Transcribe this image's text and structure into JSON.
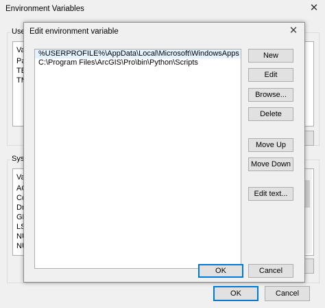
{
  "background_window": {
    "title": "Environment Variables",
    "close_glyph": "✕",
    "user_group_label": "User",
    "user_rows": [
      "Va",
      "Pa",
      "TE",
      "TM"
    ],
    "system_group_label": "Syste",
    "system_rows": [
      "Va",
      "AC",
      "Co",
      "Dr",
      "GD",
      "LS",
      "NU",
      "NU"
    ],
    "ok_label": "OK",
    "cancel_label": "Cancel"
  },
  "dialog": {
    "title": "Edit environment variable",
    "close_glyph": "✕",
    "paths": [
      "%USERPROFILE%\\AppData\\Local\\Microsoft\\WindowsApps",
      "C:\\Program Files\\ArcGIS\\Pro\\bin\\Python\\Scripts"
    ],
    "selected_index": 0,
    "buttons": {
      "new": "New",
      "edit": "Edit",
      "browse": "Browse...",
      "delete": "Delete",
      "move_up": "Move Up",
      "move_down": "Move Down",
      "edit_text": "Edit text...",
      "ok": "OK",
      "cancel": "Cancel"
    }
  },
  "colors": {
    "accent": "#0078d7",
    "selection": "#e5f3ff",
    "button_face": "#e1e1e1"
  }
}
